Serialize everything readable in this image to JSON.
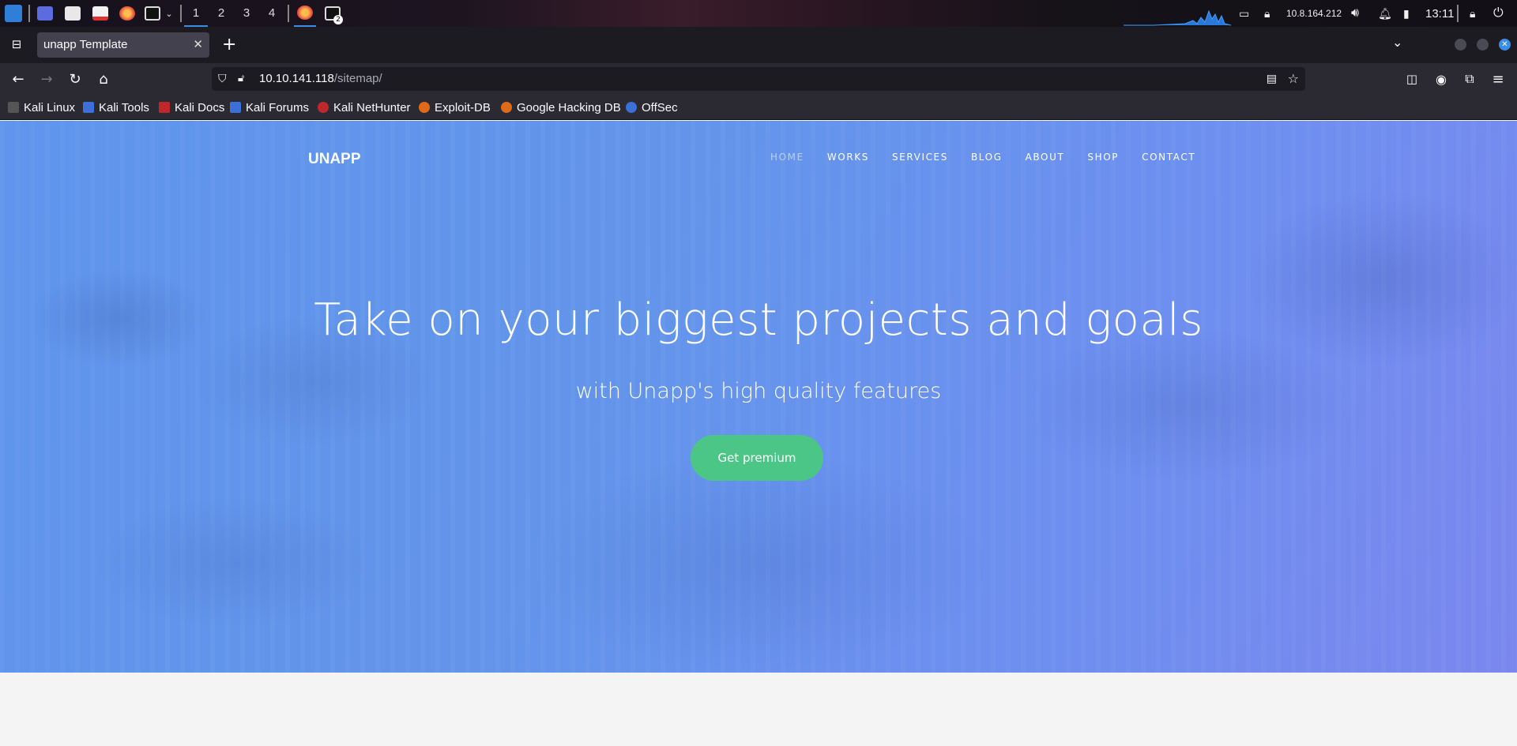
{
  "taskbar": {
    "workspaces": [
      "1",
      "2",
      "3",
      "4"
    ],
    "terminal_badge": "2",
    "ip_address": "10.8.164.212",
    "clock": "13:11"
  },
  "browser": {
    "tab_title": "unapp Template",
    "url_host": "10.10.141.118",
    "url_path": "/sitemap/",
    "bookmarks": [
      "Kali Linux",
      "Kali Tools",
      "Kali Docs",
      "Kali Forums",
      "Kali NetHunter",
      "Exploit-DB",
      "Google Hacking DB",
      "OffSec"
    ]
  },
  "site": {
    "logo": "UNAPP",
    "nav": [
      "HOME",
      "WORKS",
      "SERVICES",
      "BLOG",
      "ABOUT",
      "SHOP",
      "CONTACT"
    ],
    "headline": "Take on your biggest projects and goals",
    "subheadline": "with Unapp's high quality features",
    "cta_label": "Get premium"
  },
  "colors": {
    "hero_blue": "#6295ea",
    "cta_green": "#4cc687",
    "accent_taskbar": "#3a8ee6"
  }
}
